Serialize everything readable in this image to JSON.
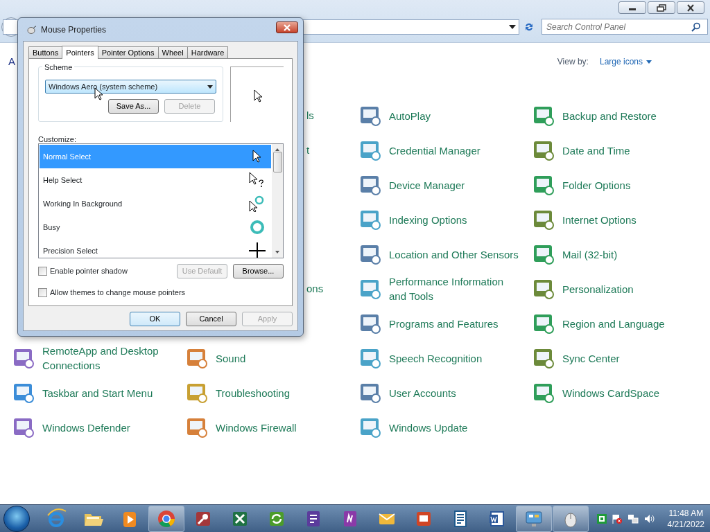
{
  "explorer": {
    "search": {
      "placeholder": "Search Control Panel"
    },
    "header_fragment": "A",
    "view_by": {
      "label": "View by:",
      "value": "Large icons"
    }
  },
  "control_panel": {
    "items": [
      {
        "kind": "covered"
      },
      {
        "kind": "fragment",
        "label": "ls"
      },
      {
        "kind": "item",
        "label": "AutoPlay"
      },
      {
        "kind": "item",
        "label": "Backup and Restore"
      },
      {
        "kind": "covered"
      },
      {
        "kind": "fragment",
        "label": "t"
      },
      {
        "kind": "item",
        "label": "Credential Manager"
      },
      {
        "kind": "item",
        "label": "Date and Time"
      },
      {
        "kind": "covered"
      },
      {
        "kind": "covered"
      },
      {
        "kind": "item",
        "label": "Device Manager"
      },
      {
        "kind": "item",
        "label": "Folder Options"
      },
      {
        "kind": "covered"
      },
      {
        "kind": "covered"
      },
      {
        "kind": "item",
        "label": "Indexing Options"
      },
      {
        "kind": "item",
        "label": "Internet Options"
      },
      {
        "kind": "covered"
      },
      {
        "kind": "covered"
      },
      {
        "kind": "item",
        "label": "Location and Other Sensors"
      },
      {
        "kind": "item",
        "label": "Mail (32-bit)"
      },
      {
        "kind": "covered"
      },
      {
        "kind": "fragment",
        "label": "ons"
      },
      {
        "kind": "item",
        "label": "Performance Information and Tools"
      },
      {
        "kind": "item",
        "label": "Personalization"
      },
      {
        "kind": "covered"
      },
      {
        "kind": "covered"
      },
      {
        "kind": "item",
        "label": "Programs and Features"
      },
      {
        "kind": "item",
        "label": "Region and Language"
      },
      {
        "kind": "item",
        "label": "RemoteApp and Desktop Connections"
      },
      {
        "kind": "item",
        "label": "Sound"
      },
      {
        "kind": "item",
        "label": "Speech Recognition"
      },
      {
        "kind": "item",
        "label": "Sync Center"
      },
      {
        "kind": "item",
        "label": "Taskbar and Start Menu"
      },
      {
        "kind": "item",
        "label": "Troubleshooting"
      },
      {
        "kind": "item",
        "label": "User Accounts"
      },
      {
        "kind": "item",
        "label": "Windows CardSpace"
      },
      {
        "kind": "item",
        "label": "Windows Defender"
      },
      {
        "kind": "item",
        "label": "Windows Firewall"
      },
      {
        "kind": "item",
        "label": "Windows Update"
      }
    ]
  },
  "dialog": {
    "title": "Mouse Properties",
    "tabs": [
      {
        "label": "Buttons",
        "selected": false
      },
      {
        "label": "Pointers",
        "selected": true
      },
      {
        "label": "Pointer Options",
        "selected": false
      },
      {
        "label": "Wheel",
        "selected": false
      },
      {
        "label": "Hardware",
        "selected": false
      }
    ],
    "scheme": {
      "legend": "Scheme",
      "value": "Windows Aero (system scheme)",
      "buttons": [
        {
          "label": "Save As...",
          "disabled": false
        },
        {
          "label": "Delete",
          "disabled": true
        }
      ]
    },
    "customize": {
      "label": "Customize:",
      "rows": [
        {
          "name": "Normal Select",
          "selected": true,
          "kind": "arrow"
        },
        {
          "name": "Help Select",
          "selected": false,
          "kind": "help"
        },
        {
          "name": "Working In Background",
          "selected": false,
          "kind": "working"
        },
        {
          "name": "Busy",
          "selected": false,
          "kind": "busy"
        },
        {
          "name": "Precision Select",
          "selected": false,
          "kind": "cross"
        }
      ]
    },
    "options": [
      {
        "label": "Enable pointer shadow",
        "checked": false
      },
      {
        "label": "Allow themes to change mouse pointers",
        "checked": false
      }
    ],
    "side_buttons": [
      {
        "label": "Use Default",
        "disabled": true
      },
      {
        "label": "Browse...",
        "disabled": false
      }
    ],
    "buttons": [
      {
        "label": "OK",
        "disabled": false,
        "default": true
      },
      {
        "label": "Cancel",
        "disabled": false,
        "default": false
      },
      {
        "label": "Apply",
        "disabled": true,
        "default": false
      }
    ]
  },
  "taskbar": {
    "apps": [
      {
        "kind": "ie",
        "running": false
      },
      {
        "kind": "folder",
        "running": false
      },
      {
        "kind": "media",
        "running": false
      },
      {
        "kind": "chrome",
        "running": true
      },
      {
        "kind": "access",
        "running": false
      },
      {
        "kind": "excel",
        "running": false
      },
      {
        "kind": "sync",
        "running": false
      },
      {
        "kind": "infopath",
        "running": false
      },
      {
        "kind": "onenote",
        "running": false
      },
      {
        "kind": "outlook",
        "running": false
      },
      {
        "kind": "powerpoint",
        "running": false
      },
      {
        "kind": "publisher",
        "running": false
      },
      {
        "kind": "word",
        "running": false
      },
      {
        "kind": "controlpanel",
        "running": true
      },
      {
        "kind": "mouse",
        "running": true
      }
    ],
    "time": "11:48 AM",
    "date": "4/21/2022"
  }
}
